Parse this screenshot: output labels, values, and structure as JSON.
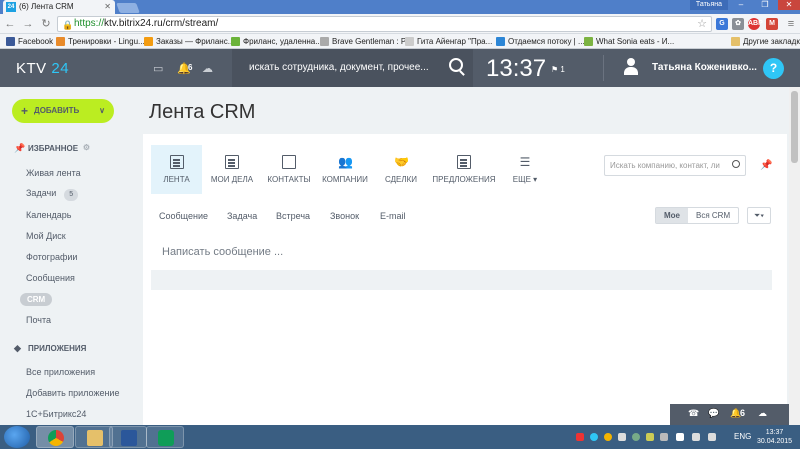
{
  "browser": {
    "tab_title": "(6) Лента CRM",
    "tab_favicon": "24",
    "window_user": "Татьяна",
    "url_https": "https://",
    "url_rest": "ktv.bitrix24.ru/crm/stream/",
    "bookmarks": [
      "Facebook",
      "Тренировки - Lingu...",
      "Заказы — Фриланс...",
      "Фриланс, удаленна...",
      "Brave Gentleman : P...",
      "Гита Айенгар \"Пра...",
      "Отдаемся потоку | ...",
      "What Sonia eats - И..."
    ],
    "other_bookmarks": "Другие закладки"
  },
  "header": {
    "logo_text": "KTV",
    "logo_num": "24",
    "notif_count": "6",
    "search_placeholder": "искать сотрудника, документ, прочее...",
    "clock": "13:37",
    "clock_flag": "1",
    "user_name": "Татьяна Коженивко...",
    "help": "?"
  },
  "sidebar": {
    "add_button": "ДОБАВИТЬ",
    "favorites_title": "ИЗБРАННОЕ",
    "items": [
      {
        "label": "Живая лента"
      },
      {
        "label": "Задачи",
        "badge": "5"
      },
      {
        "label": "Календарь"
      },
      {
        "label": "Мой Диск"
      },
      {
        "label": "Фотографии"
      },
      {
        "label": "Сообщения"
      },
      {
        "label": "CRM"
      },
      {
        "label": "Почта"
      }
    ],
    "apps_title": "ПРИЛОЖЕНИЯ",
    "apps_items": [
      "Все приложения",
      "Добавить приложение",
      "1С+Битрикс24"
    ]
  },
  "main": {
    "page_title": "Лента CRM",
    "tiles": [
      "ЛЕНТА",
      "МОИ ДЕЛА",
      "КОНТАКТЫ",
      "КОМПАНИИ",
      "СДЕЛКИ",
      "ПРЕДЛОЖЕНИЯ",
      "ЕЩЕ"
    ],
    "search_placeholder": "Искать компанию, контакт, ли",
    "sub_tabs": [
      "Сообщение",
      "Задача",
      "Встреча",
      "Звонок",
      "E-mail"
    ],
    "toggle_mine": "Мое",
    "toggle_all": "Вся CRM",
    "composer_placeholder": "Написать сообщение ..."
  },
  "notif_bar": {
    "count": "6"
  },
  "taskbar": {
    "lang": "ENG",
    "time": "13:37",
    "date": "30.04.2015"
  }
}
